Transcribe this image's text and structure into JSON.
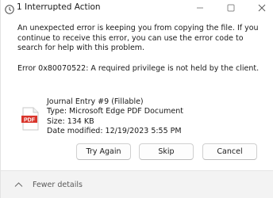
{
  "window": {
    "title": "1 Interrupted Action"
  },
  "message": {
    "text": "An unexpected error is keeping you from copying the file. If you continue to receive this error, you can use the error code to search for help with this problem.",
    "error": "Error 0x80070522: A required privilege is not held by the client."
  },
  "file": {
    "icon_label": "PDF",
    "name": "Journal Entry #9 (Fillable)",
    "type": "Type: Microsoft Edge PDF Document",
    "size": "Size: 134 KB",
    "date_modified": "Date modified: 12/19/2023 5:55 PM"
  },
  "buttons": {
    "try_again": "Try Again",
    "skip": "Skip",
    "cancel": "Cancel"
  },
  "footer": {
    "toggle_label": "Fewer details"
  },
  "colors": {
    "pdf_red": "#d9342b",
    "footer_bg": "#f3f3f3"
  }
}
